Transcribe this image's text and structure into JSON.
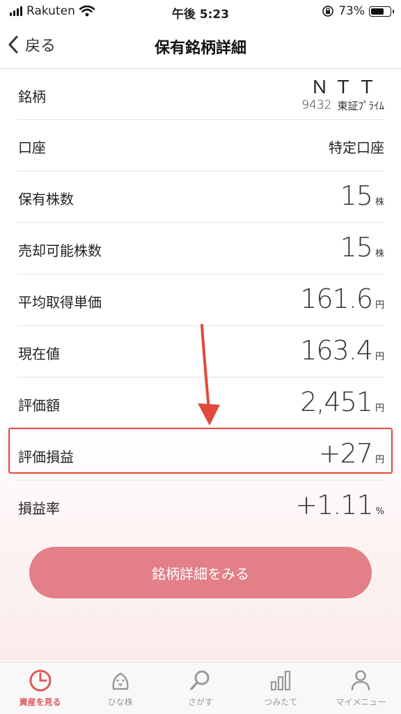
{
  "status": {
    "carrier": "Rakuten",
    "time": "午後 5:23",
    "battery_percent": "73%",
    "battery_level": 0.73
  },
  "nav": {
    "back_label": "戻る",
    "title": "保有銘柄詳細"
  },
  "stock": {
    "label": "銘柄",
    "name": "ＮＴＴ",
    "code": "9432",
    "market": "東証ﾌﾟﾗｲﾑ"
  },
  "rows": [
    {
      "label": "口座",
      "value": "特定口座"
    },
    {
      "label": "保有株数",
      "value": "15",
      "unit": "株"
    },
    {
      "label": "売却可能株数",
      "value": "15",
      "unit": "株"
    },
    {
      "label": "平均取得単価",
      "value": "161.6",
      "unit": "円"
    },
    {
      "label": "現在値",
      "value": "163.4",
      "unit": "円"
    },
    {
      "label": "評価額",
      "value": "2,451",
      "unit": "円"
    },
    {
      "label": "評価損益",
      "value": "+27",
      "unit": "円"
    },
    {
      "label": "損益率",
      "value": "+1.11",
      "unit": "%"
    }
  ],
  "cta_label": "銘柄詳細をみる",
  "tabs": [
    {
      "label": "資産を見る",
      "icon": "pie-clock-icon",
      "active": true
    },
    {
      "label": "ひな株",
      "icon": "chick-icon",
      "active": false
    },
    {
      "label": "さがす",
      "icon": "search-icon",
      "active": false
    },
    {
      "label": "つみたて",
      "icon": "bar-chart-icon",
      "active": false
    },
    {
      "label": "マイメニュー",
      "icon": "person-icon",
      "active": false
    }
  ],
  "colors": {
    "accent": "#e0575a",
    "cta": "#e27f87",
    "annotation": "#e04a3a"
  }
}
